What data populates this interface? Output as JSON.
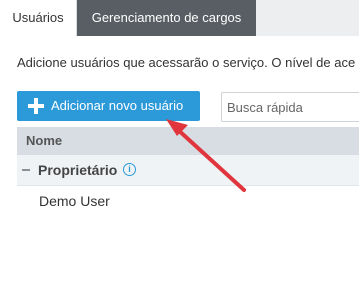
{
  "tabs": [
    {
      "label": "Usuários",
      "active": true
    },
    {
      "label": "Gerenciamento de cargos",
      "active": false
    }
  ],
  "description": "Adicione usuários que acessarão o serviço. O nível de ace",
  "add_button": {
    "label": "Adicionar novo usuário",
    "icon": "plus-icon"
  },
  "search": {
    "placeholder": "Busca rápida",
    "value": ""
  },
  "table": {
    "columns": [
      "Nome"
    ],
    "groups": [
      {
        "label": "Proprietário",
        "icon": "info-icon",
        "info_glyph": "i",
        "users": [
          "Demo User"
        ]
      }
    ]
  },
  "annotation": {
    "type": "arrow",
    "color": "#e0353d"
  },
  "colors": {
    "accent": "#2c99d9",
    "tab_active_bg": "#ffffff",
    "tab_inactive_bg": "#595e64",
    "arrow": "#e0353d"
  }
}
